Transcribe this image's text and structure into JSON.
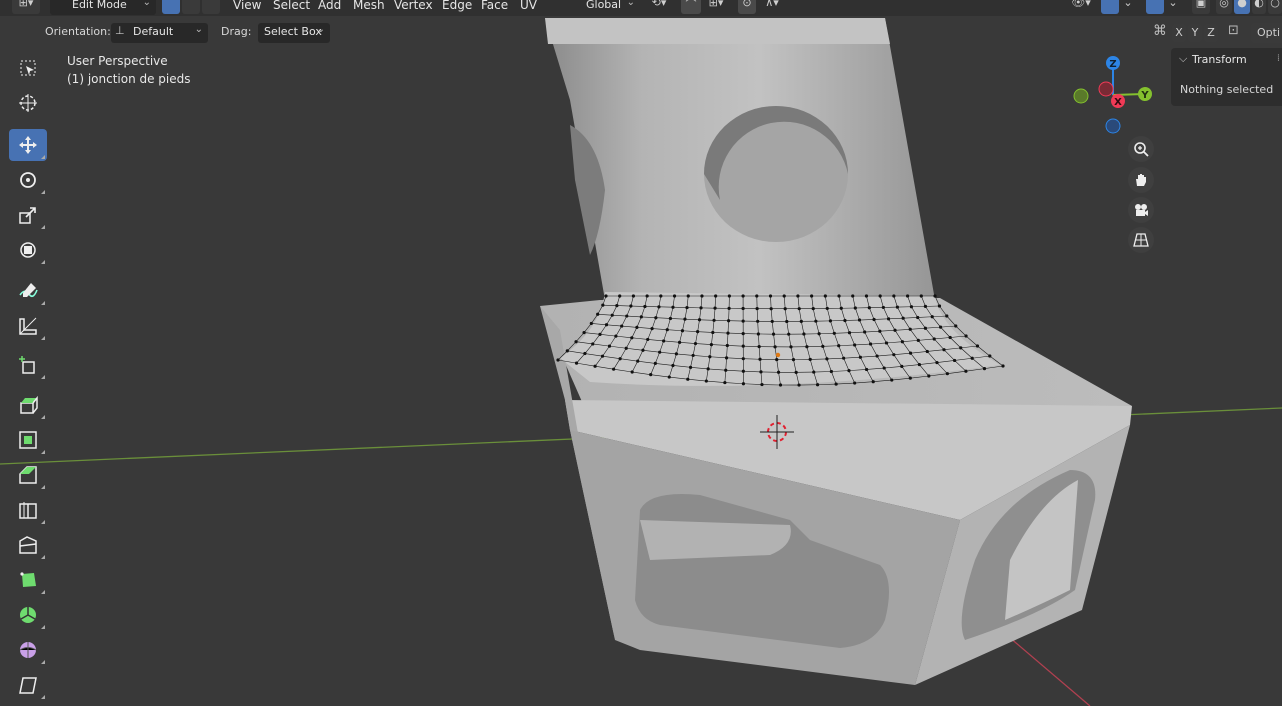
{
  "header": {
    "mode": "Edit Mode",
    "menus": [
      "View",
      "Select",
      "Add",
      "Mesh",
      "Vertex",
      "Edge",
      "Face",
      "UV"
    ],
    "transform_orientation": "Global"
  },
  "tool_header": {
    "orientation_label": "Orientation:",
    "orientation_value": "Default",
    "drag_label": "Drag:",
    "drag_value": "Select Box",
    "axis_x": "X",
    "axis_y": "Y",
    "axis_z": "Z",
    "options_label": "Opti"
  },
  "viewport": {
    "view_name": "User Perspective",
    "object_name": "(1) jonction de pieds"
  },
  "sidebar": {
    "panel_title": "Transform",
    "panel_text": "Nothing selected"
  },
  "gizmo": {
    "x": "X",
    "y": "Y",
    "z": "Z"
  },
  "tools": [
    {
      "name": "select-box-tool",
      "active": false
    },
    {
      "name": "cursor-tool",
      "active": false
    },
    {
      "name": "move-tool",
      "active": true
    },
    {
      "name": "rotate-tool",
      "active": false
    },
    {
      "name": "scale-tool",
      "active": false
    },
    {
      "name": "transform-tool",
      "active": false
    },
    {
      "name": "annotate-tool",
      "active": false
    },
    {
      "name": "measure-tool",
      "active": false
    },
    {
      "name": "add-cube-tool",
      "active": false
    },
    {
      "name": "extrude-region-tool",
      "active": false
    },
    {
      "name": "inset-faces-tool",
      "active": false
    },
    {
      "name": "bevel-tool",
      "active": false
    },
    {
      "name": "loop-cut-tool",
      "active": false
    },
    {
      "name": "knife-tool",
      "active": false
    },
    {
      "name": "poly-build-tool",
      "active": false
    },
    {
      "name": "spin-tool",
      "active": false
    },
    {
      "name": "smooth-tool",
      "active": false
    },
    {
      "name": "shear-tool",
      "active": false
    }
  ],
  "colors": {
    "accent": "#4772b3",
    "axis_x": "#f03a56",
    "axis_y": "#84c12e",
    "axis_z": "#2d85e6",
    "vertex": "#111111",
    "active_vertex": "#e07a14"
  }
}
